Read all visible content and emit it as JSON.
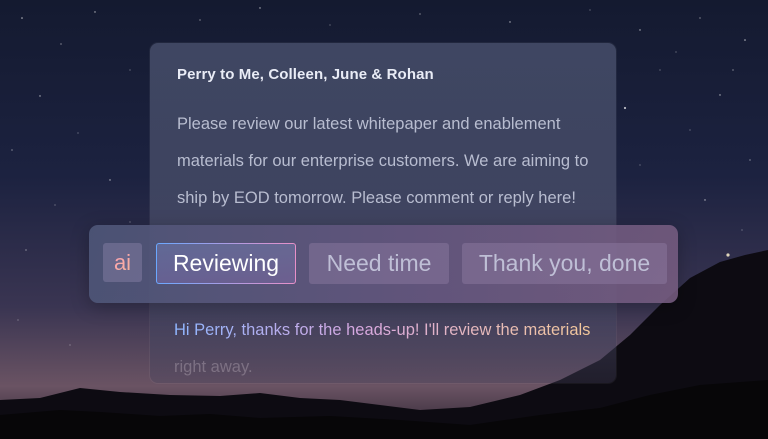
{
  "email": {
    "from_line": "Perry to Me, Colleen, June & Rohan",
    "body": "Please review our latest whitepaper and enablement materials for our enterprise customers. We are aiming to ship by EOD tomorrow.  Please comment or reply here!"
  },
  "smart_reply": {
    "badge": "ai",
    "options": [
      {
        "label": "Reviewing",
        "selected": true
      },
      {
        "label": "Need time",
        "selected": false
      },
      {
        "label": "Thank you, done",
        "selected": false
      }
    ]
  },
  "draft_reply": {
    "line1": "Hi Perry, thanks for the heads-up!  I'll review the materials",
    "line2": "right away."
  },
  "colors": {
    "sky_top": "#141a30",
    "accent_blue": "#6aa8ff",
    "accent_pink": "#e890c8",
    "accent_peach": "#f3c89a"
  }
}
